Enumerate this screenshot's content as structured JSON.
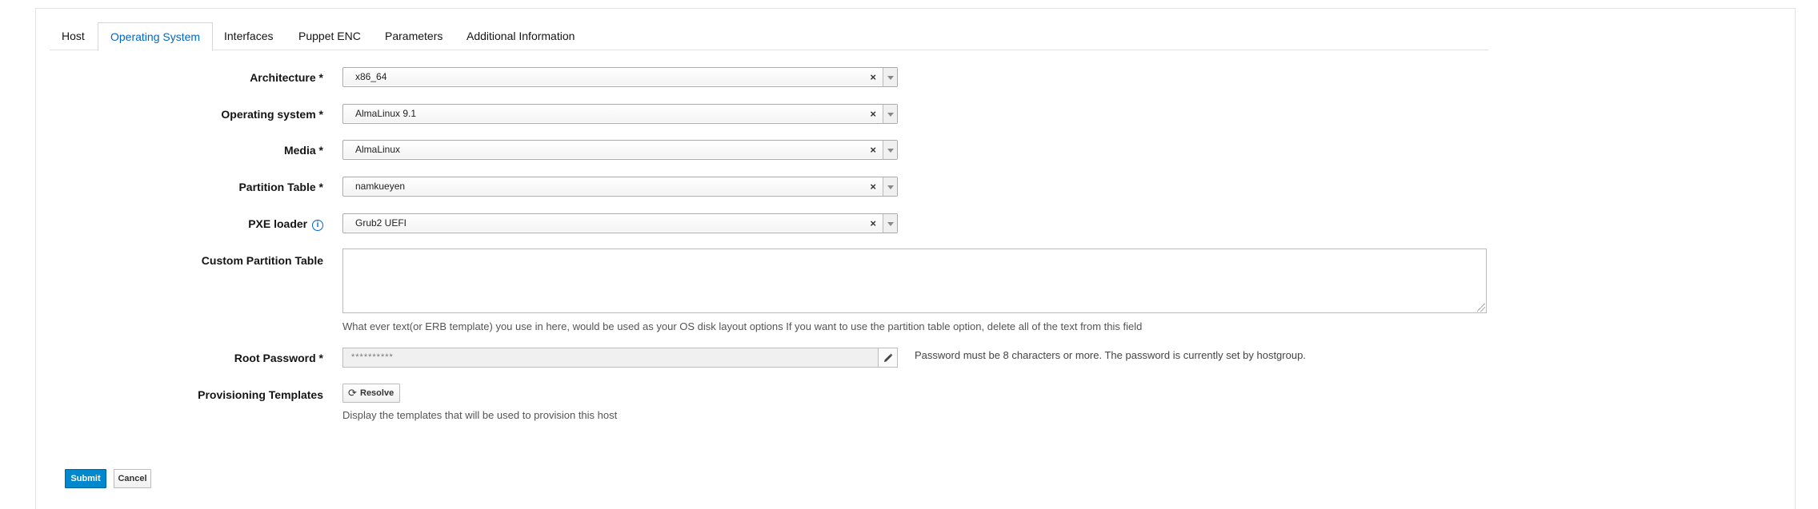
{
  "tabs": [
    {
      "label": "Host",
      "active": false
    },
    {
      "label": "Operating System",
      "active": true
    },
    {
      "label": "Interfaces",
      "active": false
    },
    {
      "label": "Puppet ENC",
      "active": false
    },
    {
      "label": "Parameters",
      "active": false
    },
    {
      "label": "Additional Information",
      "active": false
    }
  ],
  "form": {
    "architecture": {
      "label": "Architecture *",
      "value": "x86_64"
    },
    "operating_system": {
      "label": "Operating system *",
      "value": "AlmaLinux 9.1"
    },
    "media": {
      "label": "Media *",
      "value": "AlmaLinux"
    },
    "partition_table": {
      "label": "Partition Table *",
      "value": "namkueyen"
    },
    "pxe_loader": {
      "label": "PXE loader",
      "value": "Grub2 UEFI",
      "info_icon": "info-circle-icon"
    },
    "custom_partition_table": {
      "label": "Custom Partition Table",
      "value": "",
      "help": "What ever text(or ERB template) you use in here, would be used as your OS disk layout options If you want to use the partition table option, delete all of the text from this field"
    },
    "root_password": {
      "label": "Root Password *",
      "value": "**********",
      "help": "Password must be 8 characters or more. The password is currently set by hostgroup.",
      "edit_icon": "pencil-icon"
    },
    "provisioning_templates": {
      "label": "Provisioning Templates",
      "button_label": "Resolve",
      "button_icon": "refresh-icon",
      "help": "Display the templates that will be used to provision this host"
    }
  },
  "select_clear_symbol": "×",
  "actions": {
    "submit_label": "Submit",
    "cancel_label": "Cancel"
  },
  "colors": {
    "accent": "#0066cc",
    "primary_button": "#0088ce"
  }
}
